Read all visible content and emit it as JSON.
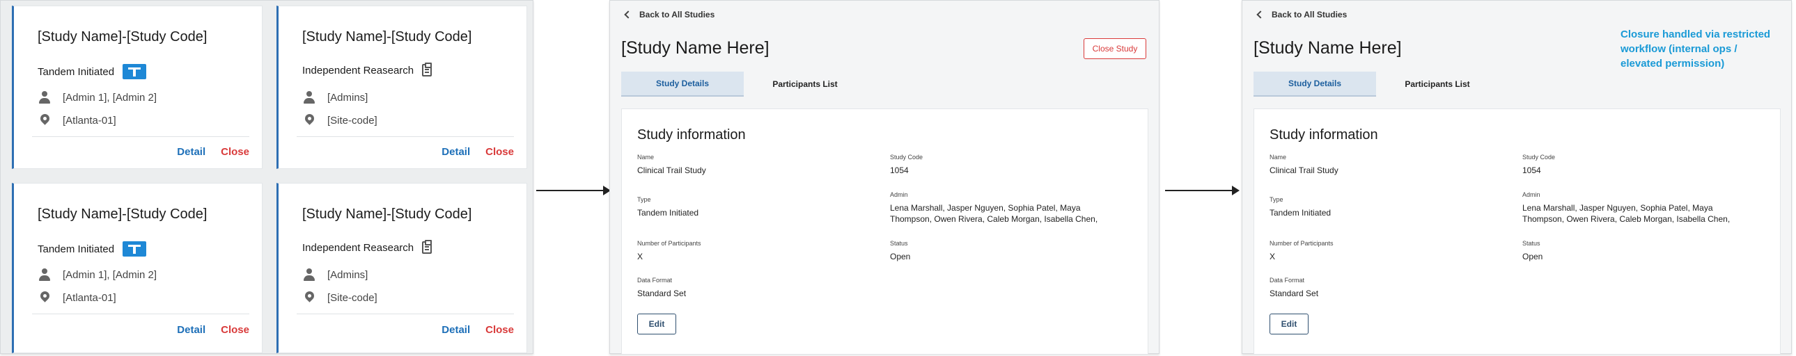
{
  "cards": [
    {
      "title": "[Study Name]-[Study Code]",
      "type": "Tandem Initiated",
      "type_icon": "tandem-t-icon",
      "admins": "[Admin 1], [Admin 2]",
      "site": "[Atlanta-01]",
      "detail_label": "Detail",
      "close_label": "Close"
    },
    {
      "title": "[Study Name]-[Study Code]",
      "type": "Independent Reasearch",
      "type_icon": "clipboard-icon",
      "admins": "[Admins]",
      "site": "[Site-code]",
      "detail_label": "Detail",
      "close_label": "Close"
    },
    {
      "title": "[Study Name]-[Study Code]",
      "type": "Tandem Initiated",
      "type_icon": "tandem-t-icon",
      "admins": "[Admin 1], [Admin 2]",
      "site": "[Atlanta-01]",
      "detail_label": "Detail",
      "close_label": "Close"
    },
    {
      "title": "[Study Name]-[Study Code]",
      "type": "Independent Reasearch",
      "type_icon": "clipboard-icon",
      "admins": "[Admins]",
      "site": "[Site-code]",
      "detail_label": "Detail",
      "close_label": "Close"
    }
  ],
  "detail_view": {
    "back_label": "Back to All Studies",
    "title": "[Study Name Here]",
    "close_study_label": "Close Study",
    "tabs": [
      "Study Details",
      "Participants List"
    ],
    "section_heading": "Study information",
    "fields": {
      "name_label": "Name",
      "name_value": "Clinical Trail Study",
      "code_label": "Study Code",
      "code_value": "1054",
      "type_label": "Type",
      "type_value": "Tandem Initiated",
      "admin_label": "Admin",
      "admin_value": "Lena Marshall, Jasper Nguyen, Sophia Patel, Maya Thompson, Owen Rivera, Caleb Morgan, Isabella Chen,",
      "participants_label": "Number of Participants",
      "participants_value": "X",
      "status_label": "Status",
      "status_value": "Open",
      "format_label": "Data Format",
      "format_value": "Standard Set"
    },
    "edit_label": "Edit"
  },
  "closure_note": "Closure handled via restricted workflow (internal ops / elevated permission)",
  "colors": {
    "accent_blue": "#1d6fb8",
    "close_red": "#d93a3a",
    "tandem_badge": "#1e88d6",
    "note_cyan": "#1a9ad6",
    "active_tab_bg": "#dbe5ef"
  }
}
